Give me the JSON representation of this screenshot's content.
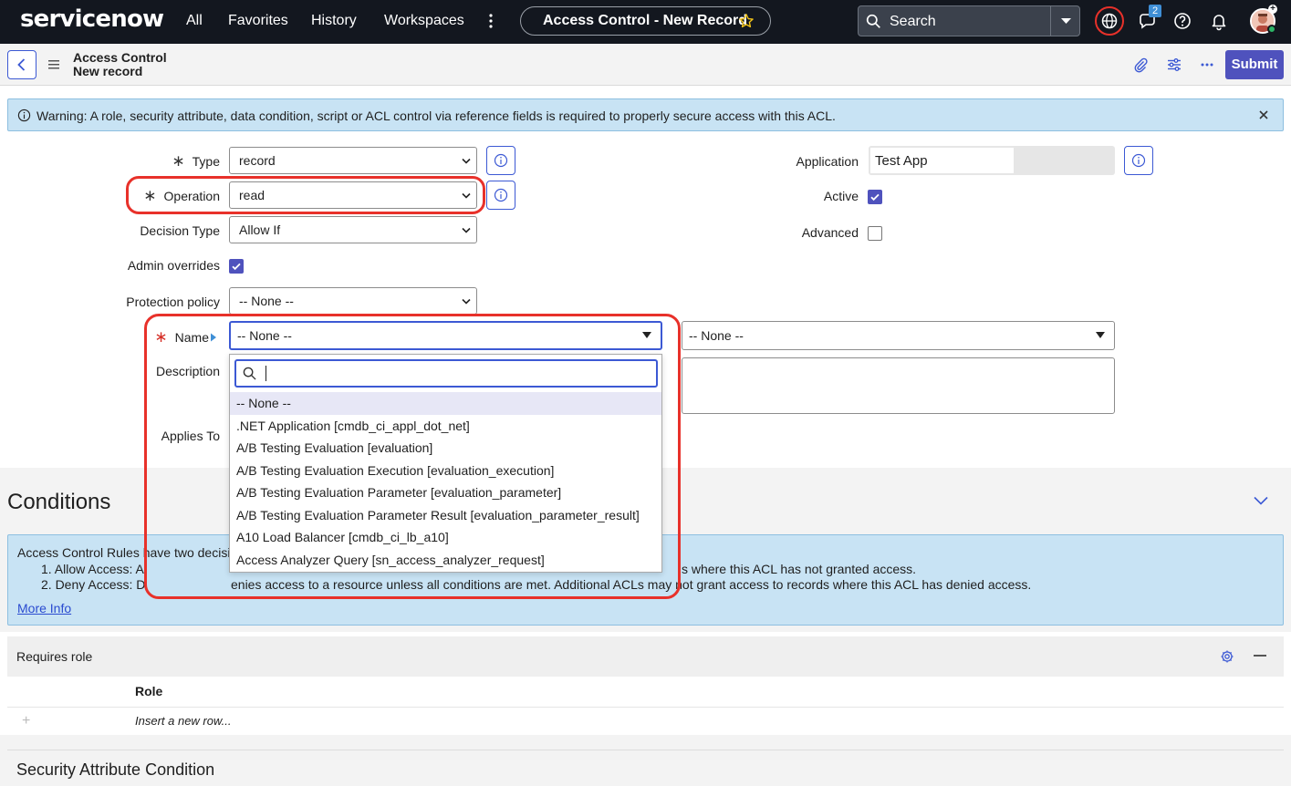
{
  "topnav": {
    "logo": "servicenow",
    "links": [
      "All",
      "Favorites",
      "History",
      "Workspaces"
    ],
    "title_pill": "Access Control - New Record",
    "search_placeholder": "Search",
    "chat_badge": "2"
  },
  "form_header": {
    "title_line1": "Access Control",
    "title_line2": "New record",
    "submit_label": "Submit"
  },
  "warning": {
    "text": "Warning: A role, security attribute, data condition, script or ACL control via reference fields is required to properly secure access with this ACL."
  },
  "form": {
    "type_label": "Type",
    "type_value": "record",
    "operation_label": "Operation",
    "operation_value": "read",
    "decision_type_label": "Decision Type",
    "decision_type_value": "Allow If",
    "admin_overrides_label": "Admin overrides",
    "admin_overrides_checked": true,
    "protection_policy_label": "Protection policy",
    "protection_policy_value": "-- None --",
    "name_label": "Name",
    "name_value": "-- None --",
    "name_second_value": "-- None --",
    "description_label": "Description",
    "applies_to_label": "Applies To",
    "application_label": "Application",
    "application_value": "Test App",
    "active_label": "Active",
    "active_checked": true,
    "advanced_label": "Advanced",
    "advanced_checked": false
  },
  "name_dropdown": {
    "options": [
      "-- None --",
      ".NET Application [cmdb_ci_appl_dot_net]",
      "A/B Testing Evaluation [evaluation]",
      "A/B Testing Evaluation Execution [evaluation_execution]",
      "A/B Testing Evaluation Parameter [evaluation_parameter]",
      "A/B Testing Evaluation Parameter Result [evaluation_parameter_result]",
      "A10 Load Balancer [cmdb_ci_lb_a10]",
      "Access Analyzer Query [sn_access_analyzer_request]"
    ],
    "selected_index": 0
  },
  "conditions": {
    "title": "Conditions",
    "info_line1": "Access Control Rules have two decisio",
    "info_line2_start": "1. Allow Access: A",
    "info_line2_end": "s where this ACL has not granted access.",
    "info_line3_start": "2. Deny Access: D",
    "info_line3_end": "enies access to a resource unless all conditions are met. Additional ACLs may not grant access to records where this ACL has denied access.",
    "more_info": "More Info"
  },
  "requires_role": {
    "title": "Requires role",
    "column": "Role",
    "insert_row": "Insert a new row..."
  },
  "security_attribute": {
    "title": "Security Attribute Condition"
  },
  "colors": {
    "nav_bg": "#13171f",
    "accent": "#4f52bd",
    "link_blue": "#3c59d4",
    "info_bg": "#c8e3f4",
    "highlight_red": "#e8312a"
  },
  "icons": [
    "star-icon",
    "search-icon",
    "chevron-down-icon",
    "globe-icon",
    "chat-icon",
    "help-icon",
    "bell-icon",
    "back-icon",
    "hamburger-icon",
    "paperclip-icon",
    "sliders-icon",
    "more-icon",
    "info-icon",
    "close-icon",
    "check-icon",
    "gear-icon"
  ]
}
